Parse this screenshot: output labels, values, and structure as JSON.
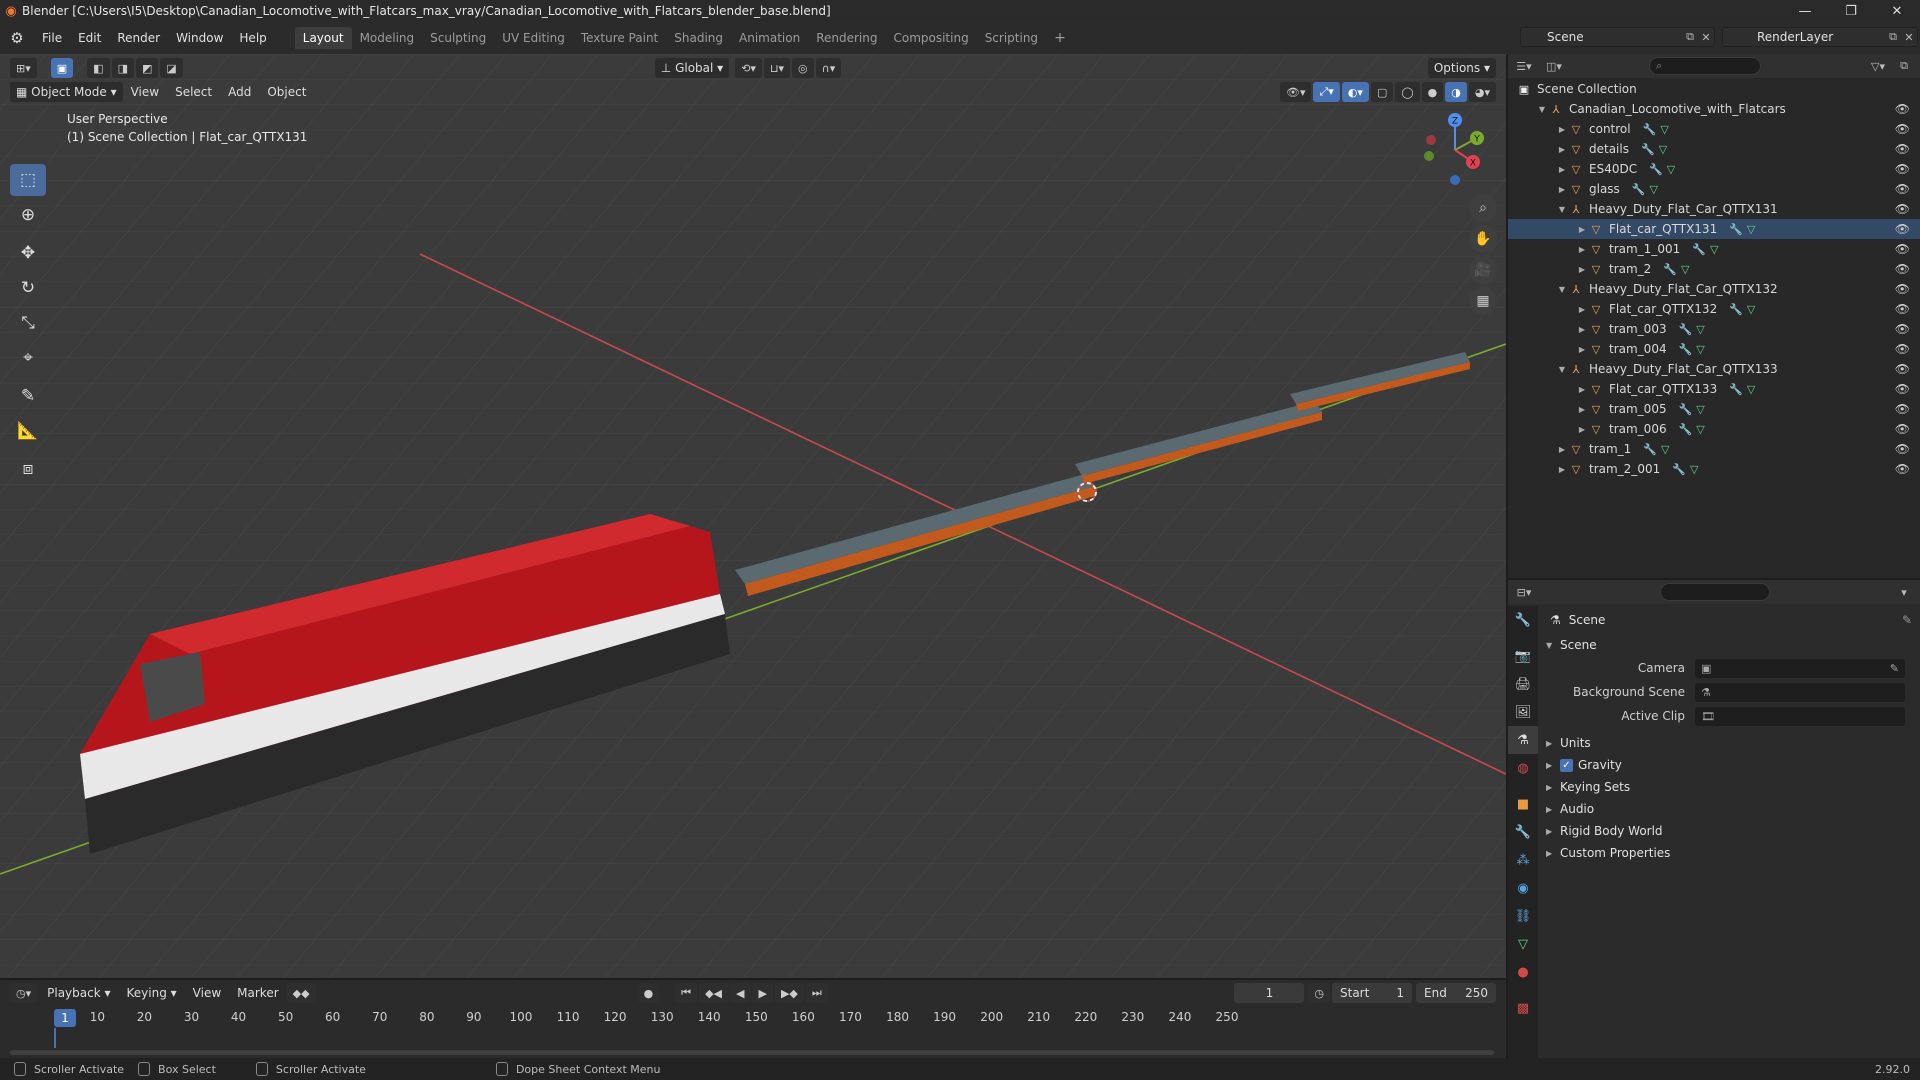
{
  "window": {
    "title": "Blender [C:\\Users\\I5\\Desktop\\Canadian_Locomotive_with_Flatcars_max_vray/Canadian_Locomotive_with_Flatcars_blender_base.blend]",
    "controls": [
      "—",
      "❐",
      "✕"
    ]
  },
  "menubar": {
    "items": [
      "File",
      "Edit",
      "Render",
      "Window",
      "Help"
    ],
    "workspaces": [
      "Layout",
      "Modeling",
      "Sculpting",
      "UV Editing",
      "Texture Paint",
      "Shading",
      "Animation",
      "Rendering",
      "Compositing",
      "Scripting"
    ],
    "active_workspace": "Layout",
    "scene": "Scene",
    "render_layer": "RenderLayer"
  },
  "viewport": {
    "mode": "Object Mode",
    "menus": [
      "View",
      "Select",
      "Add",
      "Object"
    ],
    "orientation": "Global",
    "options_label": "Options",
    "perspective_label": "User Perspective",
    "collection_label": "(1) Scene Collection | Flat_car_QTTX131",
    "tools": [
      "select-box",
      "cursor",
      "move",
      "rotate",
      "scale",
      "transform",
      "annotate",
      "measure",
      "add-cube"
    ],
    "gizmo": {
      "x": "X",
      "y": "Y",
      "z": "Z"
    },
    "colors": {
      "background": "#3b3b3b",
      "grid": "#454545",
      "x_axis": "#c84a4f",
      "y_axis": "#7bab2e",
      "locomotive": "#b5161c",
      "flatcar_deck": "#5a6a70",
      "flatcar_frame": "#c25a1d"
    }
  },
  "outliner": {
    "search_placeholder": "",
    "root": "Scene Collection",
    "rows": [
      {
        "label": "Canadian_Locomotive_with_Flatcars",
        "depth": 1,
        "type": "empty",
        "expanded": true
      },
      {
        "label": "control",
        "depth": 2,
        "type": "object"
      },
      {
        "label": "details",
        "depth": 2,
        "type": "object"
      },
      {
        "label": "ES40DC",
        "depth": 2,
        "type": "object"
      },
      {
        "label": "glass",
        "depth": 2,
        "type": "object"
      },
      {
        "label": "Heavy_Duty_Flat_Car_QTTX131",
        "depth": 2,
        "type": "empty",
        "expanded": true
      },
      {
        "label": "Flat_car_QTTX131",
        "depth": 3,
        "type": "object",
        "selected": true
      },
      {
        "label": "tram_1_001",
        "depth": 3,
        "type": "object"
      },
      {
        "label": "tram_2",
        "depth": 3,
        "type": "object"
      },
      {
        "label": "Heavy_Duty_Flat_Car_QTTX132",
        "depth": 2,
        "type": "empty",
        "expanded": true
      },
      {
        "label": "Flat_car_QTTX132",
        "depth": 3,
        "type": "object"
      },
      {
        "label": "tram_003",
        "depth": 3,
        "type": "object"
      },
      {
        "label": "tram_004",
        "depth": 3,
        "type": "object"
      },
      {
        "label": "Heavy_Duty_Flat_Car_QTTX133",
        "depth": 2,
        "type": "empty",
        "expanded": true
      },
      {
        "label": "Flat_car_QTTX133",
        "depth": 3,
        "type": "object"
      },
      {
        "label": "tram_005",
        "depth": 3,
        "type": "object"
      },
      {
        "label": "tram_006",
        "depth": 3,
        "type": "object"
      },
      {
        "label": "tram_1",
        "depth": 2,
        "type": "object"
      },
      {
        "label": "tram_2_001",
        "depth": 2,
        "type": "object"
      }
    ]
  },
  "properties": {
    "breadcrumb": "Scene",
    "section": "Scene",
    "fields": [
      {
        "label": "Camera",
        "value": ""
      },
      {
        "label": "Background Scene",
        "value": ""
      },
      {
        "label": "Active Clip",
        "value": ""
      }
    ],
    "panels": [
      {
        "label": "Units",
        "checkbox": false
      },
      {
        "label": "Gravity",
        "checkbox": true
      },
      {
        "label": "Keying Sets",
        "checkbox": false
      },
      {
        "label": "Audio",
        "checkbox": false
      },
      {
        "label": "Rigid Body World",
        "checkbox": false
      },
      {
        "label": "Custom Properties",
        "checkbox": false
      }
    ]
  },
  "timeline": {
    "menus": [
      "Playback",
      "Keying",
      "View",
      "Marker"
    ],
    "current_frame": "1",
    "start_label": "Start",
    "start": "1",
    "end_label": "End",
    "end": "250",
    "ticks": [
      "1",
      "10",
      "20",
      "30",
      "40",
      "50",
      "60",
      "70",
      "80",
      "90",
      "100",
      "110",
      "120",
      "130",
      "140",
      "150",
      "160",
      "170",
      "180",
      "190",
      "200",
      "210",
      "220",
      "230",
      "240",
      "250"
    ]
  },
  "statusbar": {
    "items": [
      "Scroller Activate",
      "Box Select",
      "Scroller Activate",
      "Dope Sheet Context Menu"
    ],
    "version": "2.92.0"
  }
}
